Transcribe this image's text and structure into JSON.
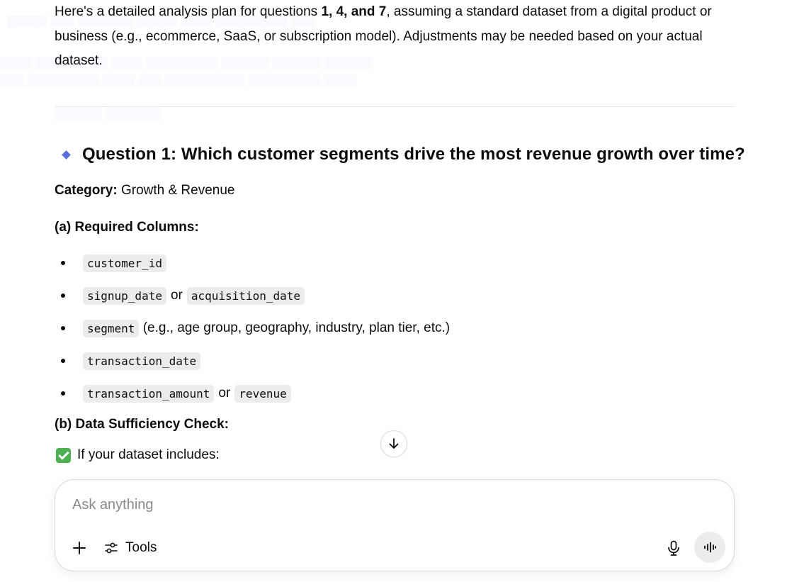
{
  "intro": {
    "part1": "Here's a detailed analysis plan for questions ",
    "bold": "1, 4, and 7",
    "part2": ", assuming a standard dataset from a digital product or business (e.g., ecommerce, SaaS, or subscription model). Adjustments may be needed based on your actual dataset."
  },
  "question": {
    "title": "Question 1: Which customer segments drive the most revenue growth over time?"
  },
  "category": {
    "label": "Category:",
    "value": " Growth & Revenue"
  },
  "required_columns": {
    "heading": "(a) Required Columns:",
    "items": [
      {
        "code1": "customer_id"
      },
      {
        "code1": "signup_date",
        "sep": "or",
        "code2": "acquisition_date"
      },
      {
        "code1": "segment",
        "text": " (e.g., age group, geography, industry, plan tier, etc.)"
      },
      {
        "code1": "transaction_date"
      },
      {
        "code1": "transaction_amount",
        "sep": "or",
        "code2": "revenue"
      }
    ]
  },
  "sufficiency": {
    "heading": "(b) Data Sufficiency Check:",
    "check_text": "If your dataset includes:"
  },
  "composer": {
    "placeholder": "Ask anything",
    "tools_label": "Tools"
  },
  "colors": {
    "accent_diamond": "#5b6ee1",
    "check_green": "#4caf50",
    "code_bg": "#ececec"
  },
  "icons": {
    "scroll": "arrow-down-icon",
    "plus": "plus-icon",
    "tools": "sliders-icon",
    "mic": "microphone-icon",
    "voice": "voice-waveform-icon"
  }
}
